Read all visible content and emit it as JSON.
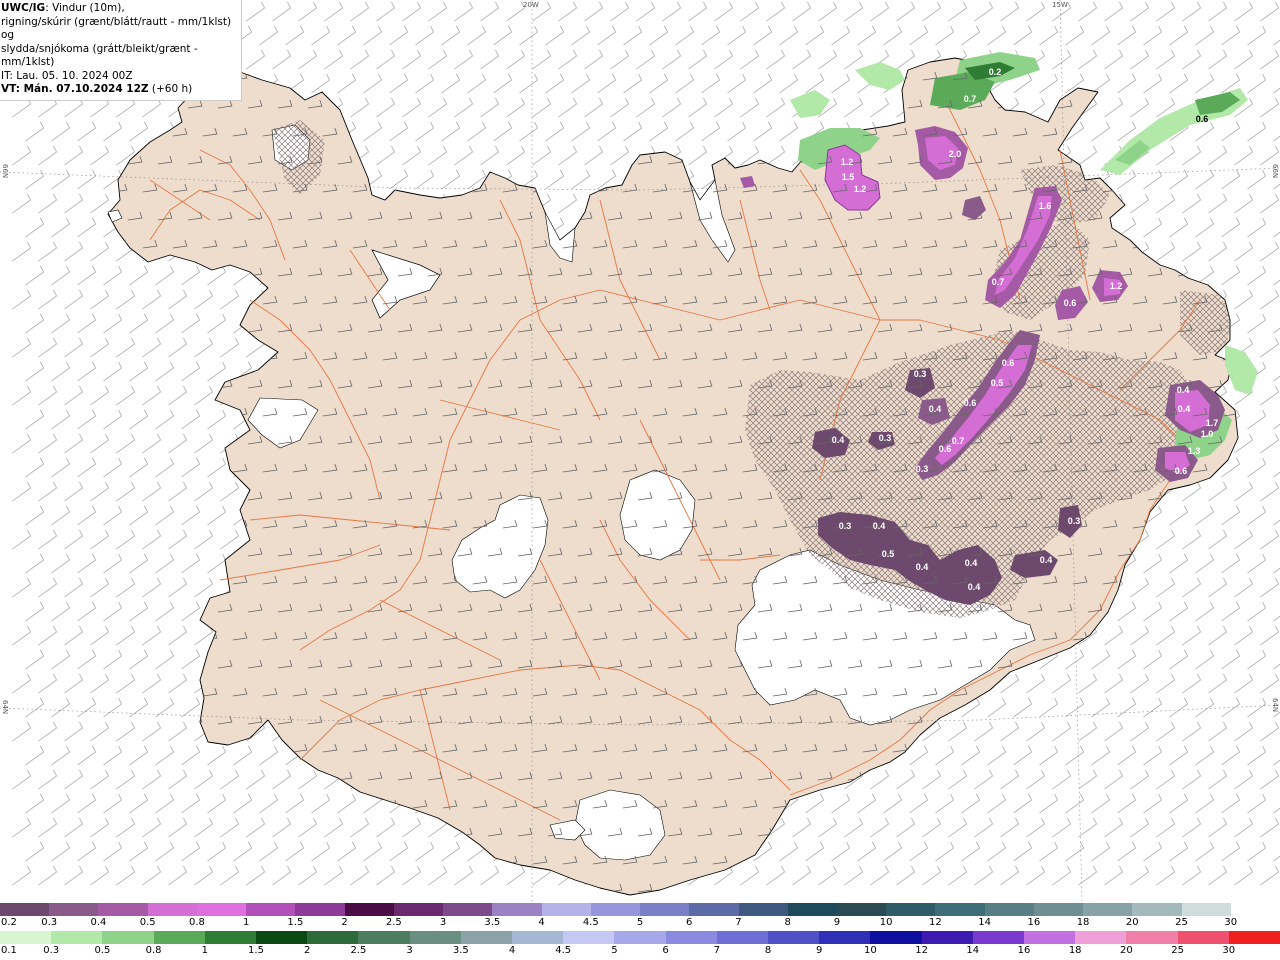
{
  "header": {
    "title_bold": "UWC/IG",
    "title_rest": ": Vindur (10m),",
    "line2": "rigning/skúrir (grænt/blátt/rautt - mm/1klst) og",
    "line3": "slydda/snjókoma (grátt/bleikt/grænt - mm/1klst)",
    "line4": "IT: Lau. 05. 10. 2024 00Z",
    "line5_bold": "VT: Mán. 07.10.2024 12Z",
    "line5_rest": " (+60 h)"
  },
  "grid_labels": {
    "lon_20w": "20W",
    "lon_15w": "15W",
    "lat_66n_left": "66N",
    "lat_66n_right": "66N",
    "lat_64n_left": "64N",
    "lat_64n_right": "64N"
  },
  "map_values": [
    {
      "text": "0.2",
      "dark": false
    },
    {
      "text": "0.7",
      "dark": false
    },
    {
      "text": "0.6",
      "dark": true
    },
    {
      "text": "1.2",
      "dark": false
    },
    {
      "text": "1.5",
      "dark": false
    },
    {
      "text": "1.2",
      "dark": false
    },
    {
      "text": "2.0",
      "dark": false
    },
    {
      "text": "1.6",
      "dark": false
    },
    {
      "text": "0.7",
      "dark": false
    },
    {
      "text": "0.6",
      "dark": false
    },
    {
      "text": "1.2",
      "dark": false
    },
    {
      "text": "0.6",
      "dark": false
    },
    {
      "text": "0.5",
      "dark": false
    },
    {
      "text": "0.3",
      "dark": false
    },
    {
      "text": "0.6",
      "dark": false
    },
    {
      "text": "0.4",
      "dark": false
    },
    {
      "text": "0.7",
      "dark": false
    },
    {
      "text": "0.6",
      "dark": false
    },
    {
      "text": "0.3",
      "dark": false
    },
    {
      "text": "0.4",
      "dark": false
    },
    {
      "text": "0.3",
      "dark": false
    },
    {
      "text": "0.4",
      "dark": false
    },
    {
      "text": "0.4",
      "dark": false
    },
    {
      "text": "1.7",
      "dark": false
    },
    {
      "text": "1.0",
      "dark": false
    },
    {
      "text": "1.3",
      "dark": false
    },
    {
      "text": "0.6",
      "dark": false
    },
    {
      "text": "0.3",
      "dark": false
    },
    {
      "text": "0.4",
      "dark": false
    },
    {
      "text": "0.5",
      "dark": false
    },
    {
      "text": "0.4",
      "dark": false
    },
    {
      "text": "0.4",
      "dark": false
    },
    {
      "text": "0.4",
      "dark": false
    },
    {
      "text": "0.4",
      "dark": false
    },
    {
      "text": "0.3",
      "dark": false
    }
  ],
  "legend_snow": {
    "labels": [
      "0.2",
      "0.3",
      "0.4",
      "0.5",
      "0.8",
      "1",
      "1.5",
      "2",
      "2.5",
      "3",
      "3.5",
      "4",
      "4.5",
      "5",
      "6",
      "7",
      "8",
      "9",
      "10",
      "12",
      "14",
      "16",
      "18",
      "20",
      "25",
      "30"
    ],
    "colors": [
      "#6d4a6d",
      "#8a5a8a",
      "#a45aa4",
      "#d46ed4",
      "#e070e0",
      "#b24fb8",
      "#8e3a98",
      "#4b0b44",
      "#6b2a6f",
      "#7d4a8a",
      "#9a82c4",
      "#b3b3ea",
      "#9696dc",
      "#7a80c8",
      "#5c6aa8",
      "#3e5a80",
      "#1f4a5c",
      "#2a4a55",
      "#2f5c66",
      "#3e6e78",
      "#587e86",
      "#6e8e94",
      "#87a3a8",
      "#a4b9bc",
      "#cfdcdc",
      "#ffffff"
    ]
  },
  "legend_rain": {
    "labels": [
      "0.1",
      "0.3",
      "0.5",
      "0.8",
      "1",
      "1.5",
      "2",
      "2.5",
      "3",
      "3.5",
      "4",
      "4.5",
      "5",
      "6",
      "7",
      "8",
      "9",
      "10",
      "12",
      "14",
      "16",
      "18",
      "20",
      "25",
      "30"
    ],
    "colors": [
      "#d8f5d0",
      "#b2e8a8",
      "#8fd38a",
      "#5aaa5a",
      "#2f7d34",
      "#0b4a14",
      "#2e6a3a",
      "#4b7d5e",
      "#6a8e82",
      "#8aa2a8",
      "#a6b7d6",
      "#c4c8f2",
      "#a6a8ea",
      "#8a8ae0",
      "#6e6ed6",
      "#5050c8",
      "#2f2fb8",
      "#1010a0",
      "#3d1ab0",
      "#7a3ad0",
      "#c070e0",
      "#f0a0d8",
      "#f080a8",
      "#f05070",
      "#f02020"
    ]
  }
}
